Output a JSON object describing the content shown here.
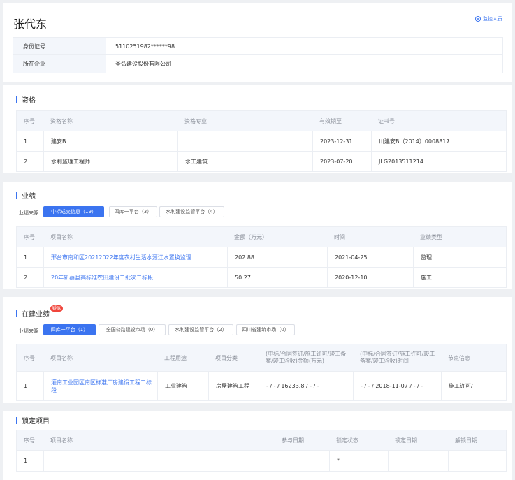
{
  "person": {
    "name": "张代东",
    "monitor_label": "监控人员",
    "id_label": "身份证号",
    "id_value": "5110251982******98",
    "company_label": "所在企业",
    "company_value": "圣弘建设股份有限公司"
  },
  "qualifications": {
    "title": "资格",
    "headers": [
      "序号",
      "资格名称",
      "资格专业",
      "有效期至",
      "证书号"
    ],
    "rows": [
      [
        "1",
        "建安B",
        "",
        "2023-12-31",
        "川建安B（2014）0008817"
      ],
      [
        "2",
        "水利监理工程师",
        "水工建筑",
        "2023-07-20",
        "JLG2013511214"
      ]
    ]
  },
  "performance": {
    "title": "业绩",
    "filter_label": "业绩来源",
    "chips": [
      "中标成交信息（19）",
      "四库一平台（3）",
      "水利建设监管平台（4）"
    ],
    "headers": [
      "序号",
      "项目名称",
      "金额（万元）",
      "时间",
      "业绩类型"
    ],
    "rows": [
      [
        "1",
        "邢台市南和区20212022年度农村生活水源江水置换监理",
        "202.88",
        "2021-04-25",
        "监理"
      ],
      [
        "2",
        "20年新蔡县高标准农田建设二批次二标段",
        "50.27",
        "2020-12-10",
        "施工"
      ]
    ]
  },
  "ongoing": {
    "title": "在建业绩",
    "badge": "疑似",
    "filter_label": "业绩来源",
    "chips": [
      "四库一平台（1）",
      "全国公路建设市场（0）",
      "水利建设监管平台（2）",
      "四川省建筑市场（0）"
    ],
    "headers": [
      "序号",
      "项目名称",
      "工程用途",
      "项目分类",
      "(中标/合同签订/施工许可/竣工备案/竣工验收)金额(万元)",
      "(中标/合同签订/施工许可/竣工备案/竣工验收)时间",
      "节点信息"
    ],
    "rows": [
      [
        "1",
        "灌南工业园区南区标准厂房建设工程二标段",
        "工业建筑",
        "房屋建筑工程",
        "- / - / 16233.8 / - / -",
        "- / - / 2018-11-07 / - / -",
        "施工许可/"
      ]
    ]
  },
  "locked": {
    "title": "锁定项目",
    "headers": [
      "序号",
      "项目名称",
      "参与日期",
      "锁定状态",
      "锁定日期",
      "解锁日期"
    ],
    "rows": [
      [
        "1",
        "",
        "",
        "*",
        "",
        ""
      ]
    ]
  },
  "colors": {
    "accent": "#3b74f0",
    "badge": "#f0453b"
  }
}
